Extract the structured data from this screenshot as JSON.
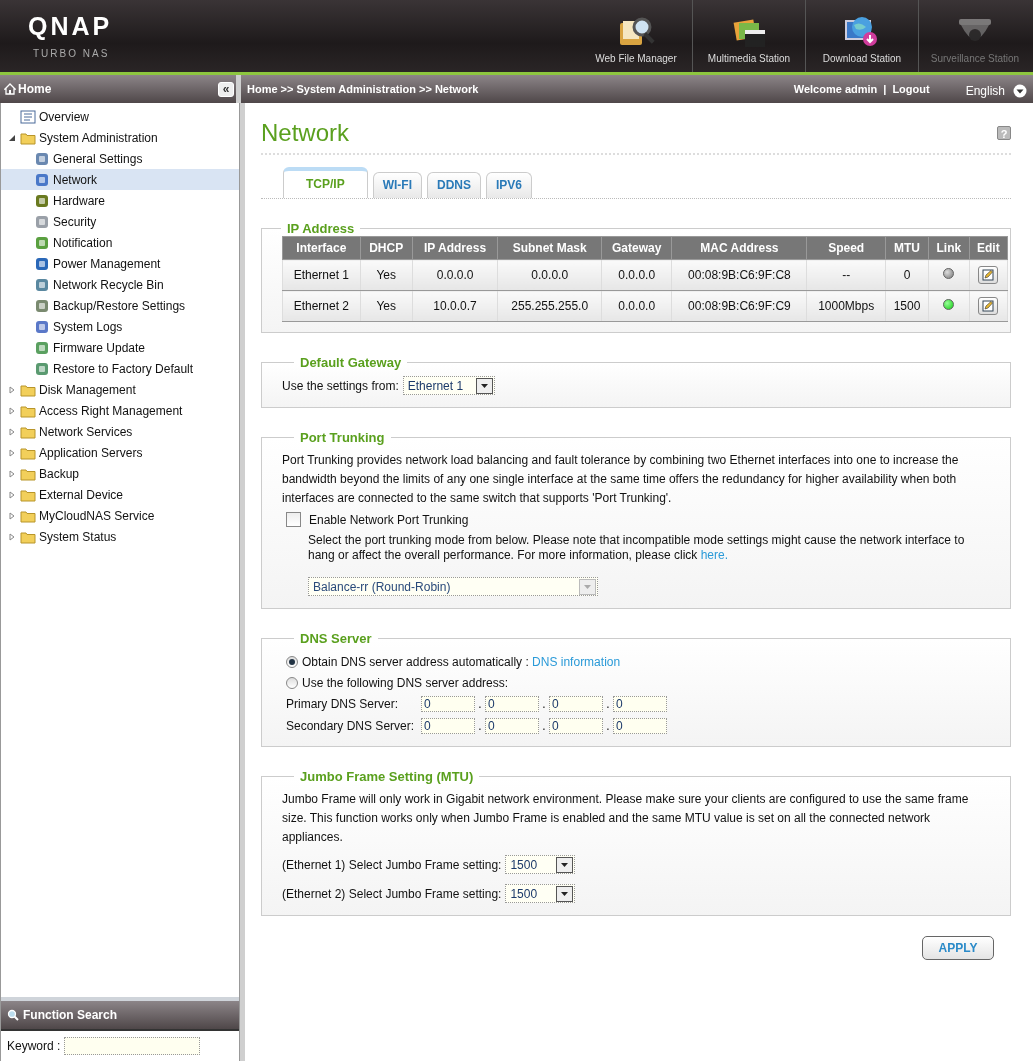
{
  "header": {
    "logo": "QNAP",
    "subtitle": "TURBO NAS",
    "apps": [
      {
        "label": "Web File Manager",
        "disabled": false
      },
      {
        "label": "Multimedia Station",
        "disabled": false
      },
      {
        "label": "Download Station",
        "disabled": false
      },
      {
        "label": "Surveillance Station",
        "disabled": true
      }
    ]
  },
  "sidebar": {
    "title": "Home",
    "collapse": "«",
    "items": [
      {
        "label": "Overview",
        "kind": "page",
        "selected": false
      },
      {
        "label": "System Administration",
        "kind": "folder",
        "expanded": true,
        "selected": false,
        "children": [
          {
            "label": "General Settings",
            "selected": false
          },
          {
            "label": "Network",
            "selected": true
          },
          {
            "label": "Hardware",
            "selected": false
          },
          {
            "label": "Security",
            "selected": false
          },
          {
            "label": "Notification",
            "selected": false
          },
          {
            "label": "Power Management",
            "selected": false
          },
          {
            "label": "Network Recycle Bin",
            "selected": false
          },
          {
            "label": "Backup/Restore Settings",
            "selected": false
          },
          {
            "label": "System Logs",
            "selected": false
          },
          {
            "label": "Firmware Update",
            "selected": false
          },
          {
            "label": "Restore to Factory Default",
            "selected": false
          }
        ]
      },
      {
        "label": "Disk Management",
        "kind": "folder",
        "expanded": false,
        "selected": false
      },
      {
        "label": "Access Right Management",
        "kind": "folder",
        "expanded": false,
        "selected": false
      },
      {
        "label": "Network Services",
        "kind": "folder",
        "expanded": false,
        "selected": false
      },
      {
        "label": "Application Servers",
        "kind": "folder",
        "expanded": false,
        "selected": false
      },
      {
        "label": "Backup",
        "kind": "folder",
        "expanded": false,
        "selected": false
      },
      {
        "label": "External Device",
        "kind": "folder",
        "expanded": false,
        "selected": false
      },
      {
        "label": "MyCloudNAS Service",
        "kind": "folder",
        "expanded": false,
        "selected": false
      },
      {
        "label": "System Status",
        "kind": "folder",
        "expanded": false,
        "selected": false
      }
    ]
  },
  "function_search": {
    "title": "Function Search",
    "label": "Keyword :"
  },
  "topbar": {
    "breadcrumb": "Home >> System Administration >> Network",
    "welcome": "Welcome admin",
    "separator": "|",
    "logout": "Logout",
    "language": "English"
  },
  "page": {
    "title": "Network",
    "help": "?",
    "tabs": [
      {
        "label": "TCP/IP",
        "selected": true
      },
      {
        "label": "WI-FI",
        "selected": false
      },
      {
        "label": "DDNS",
        "selected": false
      },
      {
        "label": "IPV6",
        "selected": false
      }
    ],
    "ip_address": {
      "title": "IP Address",
      "columns": [
        "Interface",
        "DHCP",
        "IP Address",
        "Subnet Mask",
        "Gateway",
        "MAC Address",
        "Speed",
        "MTU",
        "Link",
        "Edit"
      ],
      "rows": [
        {
          "cells": [
            "Ethernet 1",
            "Yes",
            "0.0.0.0",
            "0.0.0.0",
            "0.0.0.0",
            "00:08:9B:C6:9F:C8",
            "--",
            "0"
          ],
          "link_up": false
        },
        {
          "cells": [
            "Ethernet 2",
            "Yes",
            "10.0.0.7",
            "255.255.255.0",
            "0.0.0.0",
            "00:08:9B:C6:9F:C9",
            "1000Mbps",
            "1500"
          ],
          "link_up": true
        }
      ]
    },
    "default_gateway": {
      "title": "Default Gateway",
      "label": "Use the settings from:",
      "value": "Ethernet 1"
    },
    "port_trunking": {
      "title": "Port Trunking",
      "description": "Port Trunking provides network load balancing and fault tolerance by combining two Ethernet interfaces into one to increase the bandwidth beyond the limits of any one single interface at the same time offers the redundancy for higher availability when both interfaces are connected to the same switch that supports 'Port Trunking'.",
      "enable": {
        "label": "Enable Network Port Trunking",
        "checked": false
      },
      "hint": "Select the port trunking mode from below. Please note that incompatible mode settings might cause the network interface to hang or affect the overall performance. For more information, please click",
      "hint_link": "here.",
      "mode": {
        "value": "Balance-rr (Round-Robin)",
        "disabled": true
      }
    },
    "dns": {
      "title": "DNS Server",
      "options": [
        {
          "label": "Obtain DNS server address automatically :",
          "link": "DNS information",
          "selected": true
        },
        {
          "label": "Use the following DNS server address:",
          "selected": false
        }
      ],
      "servers": [
        {
          "label": "Primary DNS Server:",
          "octets": [
            "0",
            "0",
            "0",
            "0"
          ]
        },
        {
          "label": "Secondary DNS Server:",
          "octets": [
            "0",
            "0",
            "0",
            "0"
          ]
        }
      ],
      "octet_separator": "."
    },
    "jumbo": {
      "title": "Jumbo Frame Setting (MTU)",
      "description": "Jumbo Frame will only work in Gigabit network environment. Please make sure your clients are configured to use the same frame size. This function works only when Jumbo Frame is enabled and the same MTU value is set on all the connected network appliances.",
      "settings": [
        {
          "label": "(Ethernet 1) Select Jumbo Frame setting:",
          "value": "1500"
        },
        {
          "label": "(Ethernet 2) Select Jumbo Frame setting:",
          "value": "1500"
        }
      ]
    },
    "apply": "APPLY"
  }
}
